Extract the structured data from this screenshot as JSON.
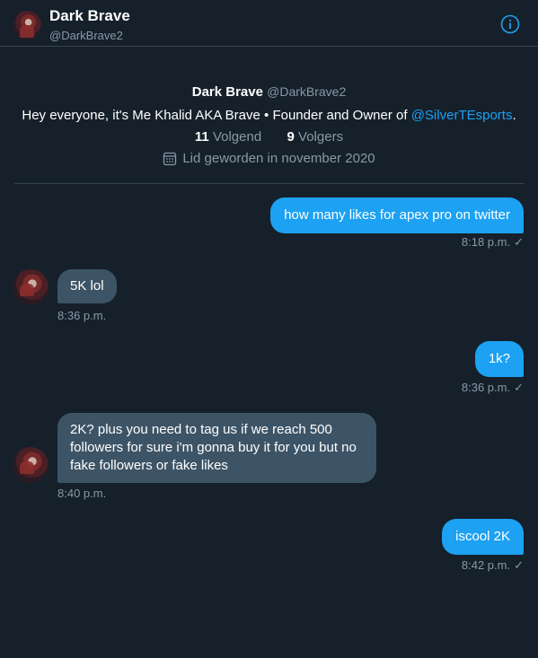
{
  "header": {
    "name": "Dark Brave",
    "handle": "@DarkBrave2"
  },
  "profile": {
    "name": "Dark Brave",
    "handle": "@DarkBrave2",
    "bio_prefix": "Hey everyone, it's Me Khalid AKA Brave • Founder and Owner of ",
    "bio_mention": "@SilverTEsports",
    "bio_suffix": ".",
    "following_count": "11",
    "following_label": "Volgend",
    "followers_count": "9",
    "followers_label": "Volgers",
    "joined": "Lid geworden in november 2020"
  },
  "messages": [
    {
      "direction": "out",
      "text": "how many likes for apex pro on twitter",
      "time": "8:18 p.m."
    },
    {
      "direction": "in",
      "text": "5K lol",
      "time": "8:36 p.m."
    },
    {
      "direction": "out",
      "text": "1k?",
      "time": "8:36 p.m."
    },
    {
      "direction": "in",
      "text": "2K? plus you need to tag us if we reach 500 followers for sure i'm gonna buy it for you but no fake followers or fake likes",
      "time": "8:40 p.m."
    },
    {
      "direction": "out",
      "text": "iscool 2K",
      "time": "8:42 p.m."
    }
  ],
  "colors": {
    "background": "#15202b",
    "accent": "#1da1f2",
    "incoming_bubble": "#3d5466",
    "secondary_text": "#8899a6"
  }
}
